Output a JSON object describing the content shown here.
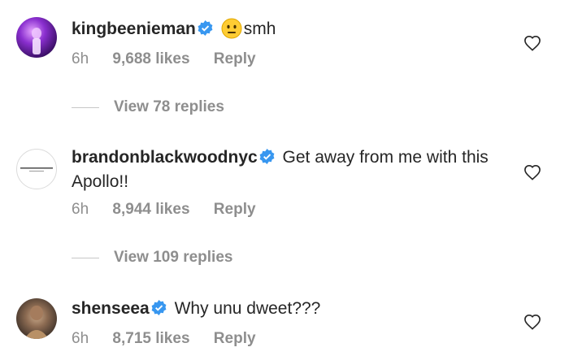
{
  "comments": [
    {
      "username": "kingbeenieman",
      "verified": true,
      "emoji": "😐",
      "text": "smh",
      "time": "6h",
      "likes": "9,688 likes",
      "reply_label": "Reply",
      "view_replies": "View 78 replies"
    },
    {
      "username": "brandonblackwoodnyc",
      "verified": true,
      "text": "Get away from me with this Apollo!!",
      "time": "6h",
      "likes": "8,944 likes",
      "reply_label": "Reply",
      "view_replies": "View 109 replies"
    },
    {
      "username": "shenseea",
      "verified": true,
      "text": "Why unu dweet???",
      "time": "6h",
      "likes": "8,715 likes",
      "reply_label": "Reply"
    }
  ],
  "colors": {
    "text": "#262626",
    "secondary": "#8e8e8e",
    "verified": "#3897f0"
  }
}
